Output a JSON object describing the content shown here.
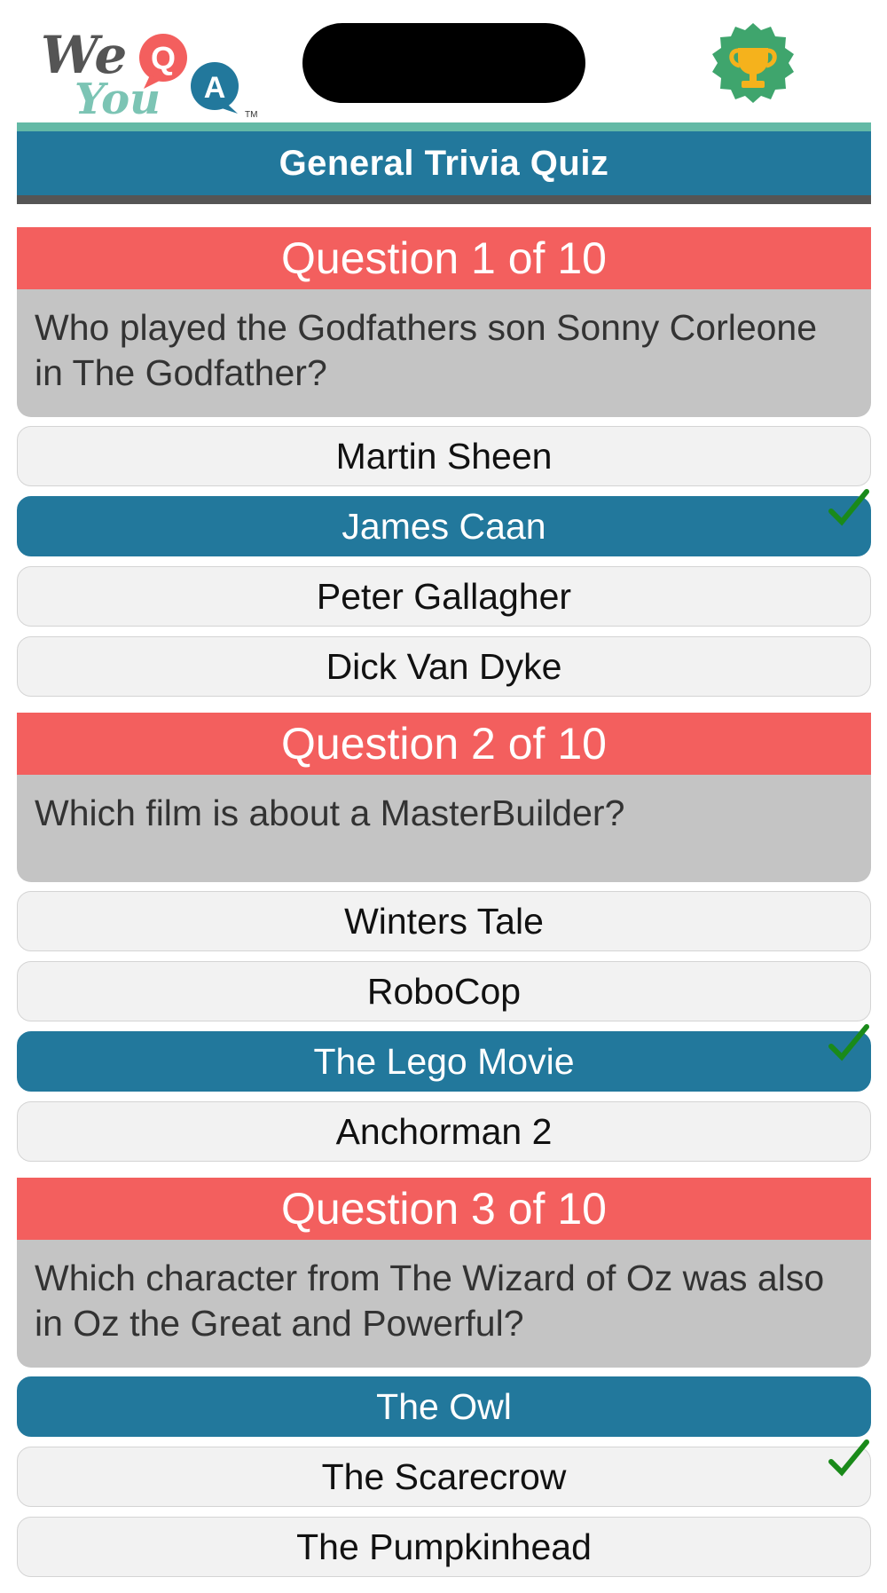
{
  "app": {
    "logo_text": "WeQAYou",
    "notch_icon": "camera-notch",
    "trophy_icon": "trophy-icon"
  },
  "title": "General Trivia Quiz",
  "colors": {
    "accent": "#22789c",
    "question_header": "#f35f5e",
    "question_body": "#c4c4c4",
    "answer_bg": "#f2f2f2",
    "check": "#1a8a1a"
  },
  "questions": [
    {
      "header": "Question 1 of 10",
      "text": "Who played the Godfathers son Sonny Corleone in The Godfather?",
      "answers": [
        {
          "label": "Martin Sheen",
          "selected": false,
          "correct": false
        },
        {
          "label": "James Caan",
          "selected": true,
          "correct": true
        },
        {
          "label": "Peter Gallagher",
          "selected": false,
          "correct": false
        },
        {
          "label": "Dick Van Dyke",
          "selected": false,
          "correct": false
        }
      ]
    },
    {
      "header": "Question 2 of 10",
      "text": "Which film is about a MasterBuilder?",
      "answers": [
        {
          "label": "Winters Tale",
          "selected": false,
          "correct": false
        },
        {
          "label": "RoboCop",
          "selected": false,
          "correct": false
        },
        {
          "label": "The Lego Movie",
          "selected": true,
          "correct": true
        },
        {
          "label": "Anchorman 2",
          "selected": false,
          "correct": false
        }
      ]
    },
    {
      "header": "Question 3 of 10",
      "text": "Which character from The Wizard of Oz was also in Oz the Great and Powerful?",
      "answers": [
        {
          "label": "The Owl",
          "selected": true,
          "correct": false
        },
        {
          "label": "The Scarecrow",
          "selected": false,
          "correct": true
        },
        {
          "label": "The Pumpkinhead",
          "selected": false,
          "correct": false
        }
      ]
    }
  ]
}
